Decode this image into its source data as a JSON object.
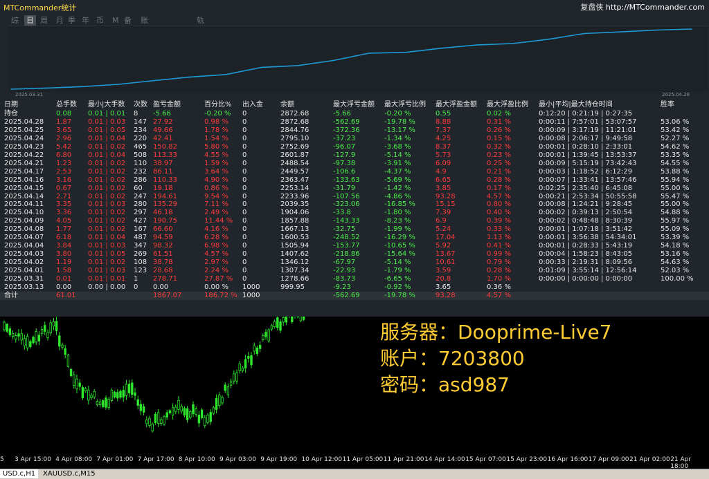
{
  "app": {
    "title": "MTCommander统计",
    "brand_label": "复盘侠",
    "brand_url": "http://MTCommander.com"
  },
  "tabs": [
    "综",
    "日",
    "周",
    "月",
    "季",
    "年",
    "币",
    "M",
    "备",
    "账户",
    "轨迹"
  ],
  "active_tab": "日",
  "equity_chart": {
    "start_date": "2025.03.31",
    "end_date": "2025.04.28",
    "line_color": "#1e9bd7"
  },
  "chart_data": {
    "type": "line",
    "x": [
      "2025.03.13",
      "2025.03.31",
      "2025.04.01",
      "2025.04.02",
      "2025.04.03",
      "2025.04.04",
      "2025.04.07",
      "2025.04.08",
      "2025.04.09",
      "2025.04.10",
      "2025.04.11",
      "2025.04.14",
      "2025.04.15",
      "2025.04.16",
      "2025.04.17",
      "2025.04.21",
      "2025.04.22",
      "2025.04.23",
      "2025.04.24",
      "2025.04.25",
      "2025.04.28"
    ],
    "series": [
      {
        "values": [
          999.95,
          1278.66,
          1307.34,
          1346.12,
          1407.62,
          1505.94,
          1600.53,
          1667.13,
          1857.88,
          1904.06,
          2039.35,
          2233.96,
          2253.14,
          2363.47,
          2449.57,
          2488.54,
          2601.87,
          2752.69,
          2795.1,
          2844.76,
          2872.68
        ]
      }
    ]
  },
  "columns": [
    "日期",
    "总手数",
    "最小|大手数",
    "次数",
    "盈亏金额",
    "百分比%",
    "出入金",
    "余额",
    "最大浮亏金额",
    "最大浮亏比例",
    "最大浮盈金额",
    "最大浮盈比例",
    "最小|平均|最大持仓时间",
    "胜率"
  ],
  "holding_row": {
    "date": "持仓",
    "lots": "0.08",
    "minmax": "0.01 | 0.01",
    "trades": "8",
    "pl": "-5.66",
    "pct": "-0.20 %",
    "io": "0",
    "bal": "2872.68",
    "dd": "-5.66",
    "ddp": "-0.20 %",
    "fp": "0.55",
    "fpp": "0.02 %",
    "hold": "0:12:20 | 0:21:19 | 0:27:35",
    "win": ""
  },
  "rows": [
    {
      "date": "2025.04.28",
      "lots": "1.87",
      "minmax": "0.01 | 0.03",
      "trades": "147",
      "pl": "27.92",
      "pct": "0.98 %",
      "io": "0",
      "bal": "2872.68",
      "dd": "-562.69",
      "ddp": "-19.78 %",
      "fp": "8.88",
      "fpp": "0.31 %",
      "hold": "0:00:11 | 7:57:01 | 53:07:57",
      "win": "53.06 %"
    },
    {
      "date": "2025.04.25",
      "lots": "3.65",
      "minmax": "0.01 | 0.05",
      "trades": "234",
      "pl": "49.66",
      "pct": "1.78 %",
      "io": "0",
      "bal": "2844.76",
      "dd": "-372.36",
      "ddp": "-13.17 %",
      "fp": "7.37",
      "fpp": "0.26 %",
      "hold": "0:00:09 | 3:17:19 | 11:21:01",
      "win": "53.42 %"
    },
    {
      "date": "2025.04.24",
      "lots": "2.96",
      "minmax": "0.01 | 0.04",
      "trades": "220",
      "pl": "42.41",
      "pct": "1.54 %",
      "io": "0",
      "bal": "2795.10",
      "dd": "-37.23",
      "ddp": "-1.34 %",
      "fp": "4.25",
      "fpp": "0.15 %",
      "hold": "0:00:08 | 2:06:17 | 9:49:58",
      "win": "52.27 %"
    },
    {
      "date": "2025.04.23",
      "lots": "5.42",
      "minmax": "0.01 | 0.02",
      "trades": "465",
      "pl": "150.82",
      "pct": "5.80 %",
      "io": "0",
      "bal": "2752.69",
      "dd": "-96.07",
      "ddp": "-3.68 %",
      "fp": "8.37",
      "fpp": "0.32 %",
      "hold": "0:00:01 | 0:28:10 | 2:33:01",
      "win": "54.62 %"
    },
    {
      "date": "2025.04.22",
      "lots": "6.80",
      "minmax": "0.01 | 0.04",
      "trades": "508",
      "pl": "113.33",
      "pct": "4.55 %",
      "io": "0",
      "bal": "2601.87",
      "dd": "-127.9",
      "ddp": "-5.14 %",
      "fp": "5.73",
      "fpp": "0.23 %",
      "hold": "0:00:01 | 1:39:45 | 13:53:37",
      "win": "53.35 %"
    },
    {
      "date": "2025.04.21",
      "lots": "1.23",
      "minmax": "0.01 | 0.02",
      "trades": "110",
      "pl": "38.97",
      "pct": "1.59 %",
      "io": "0",
      "bal": "2488.54",
      "dd": "-97.38",
      "ddp": "-3.91 %",
      "fp": "6.09",
      "fpp": "0.25 %",
      "hold": "0:00:09 | 5:15:19 | 73:42:43",
      "win": "54.55 %"
    },
    {
      "date": "2025.04.17",
      "lots": "2.53",
      "minmax": "0.01 | 0.02",
      "trades": "232",
      "pl": "86.11",
      "pct": "3.64 %",
      "io": "0",
      "bal": "2449.57",
      "dd": "-106.6",
      "ddp": "-4.37 %",
      "fp": "4.9",
      "fpp": "0.21 %",
      "hold": "0:00:03 | 1:18:52 | 6:12:29",
      "win": "53.88 %"
    },
    {
      "date": "2025.04.16",
      "lots": "3.16",
      "minmax": "0.01 | 0.02",
      "trades": "286",
      "pl": "110.33",
      "pct": "4.90 %",
      "io": "0",
      "bal": "2363.47",
      "dd": "-133.63",
      "ddp": "-5.69 %",
      "fp": "6.65",
      "fpp": "0.28 %",
      "hold": "0:00:07 | 1:33:41 | 13:57:46",
      "win": "55.94 %"
    },
    {
      "date": "2025.04.15",
      "lots": "0.67",
      "minmax": "0.01 | 0.02",
      "trades": "60",
      "pl": "19.18",
      "pct": "0.86 %",
      "io": "0",
      "bal": "2253.14",
      "dd": "-31.79",
      "ddp": "-1.42 %",
      "fp": "3.85",
      "fpp": "0.17 %",
      "hold": "0:02:25 | 2:35:40 | 6:45:08",
      "win": "55.00 %"
    },
    {
      "date": "2025.04.14",
      "lots": "2.71",
      "minmax": "0.01 | 0.02",
      "trades": "247",
      "pl": "194.61",
      "pct": "9.54 %",
      "io": "0",
      "bal": "2233.96",
      "dd": "-107.56",
      "ddp": "-4.86 %",
      "fp": "93.28",
      "fpp": "4.57 %",
      "hold": "0:00:21 | 2:53:34 | 50:55:58",
      "win": "55.47 %"
    },
    {
      "date": "2025.04.11",
      "lots": "3.35",
      "minmax": "0.01 | 0.03",
      "trades": "280",
      "pl": "135.29",
      "pct": "7.11 %",
      "io": "0",
      "bal": "2039.35",
      "dd": "-323.06",
      "ddp": "-16.85 %",
      "fp": "15.15",
      "fpp": "0.80 %",
      "hold": "0:00:08 | 1:24:21 | 9:28:45",
      "win": "55.00 %"
    },
    {
      "date": "2025.04.10",
      "lots": "3.36",
      "minmax": "0.01 | 0.02",
      "trades": "297",
      "pl": "46.18",
      "pct": "2.49 %",
      "io": "0",
      "bal": "1904.06",
      "dd": "-33.8",
      "ddp": "-1.80 %",
      "fp": "7.39",
      "fpp": "0.40 %",
      "hold": "0:00:02 | 0:39:13 | 2:50:54",
      "win": "54.88 %"
    },
    {
      "date": "2025.04.09",
      "lots": "4.05",
      "minmax": "0.01 | 0.02",
      "trades": "427",
      "pl": "190.75",
      "pct": "11.44 %",
      "io": "0",
      "bal": "1857.88",
      "dd": "-143.33",
      "ddp": "-8.23 %",
      "fp": "6.9",
      "fpp": "0.39 %",
      "hold": "0:00:02 | 0:48:48 | 8:30:39",
      "win": "55.97 %"
    },
    {
      "date": "2025.04.08",
      "lots": "1.77",
      "minmax": "0.01 | 0.02",
      "trades": "167",
      "pl": "66.60",
      "pct": "4.16 %",
      "io": "0",
      "bal": "1667.13",
      "dd": "-32.75",
      "ddp": "-1.99 %",
      "fp": "5.24",
      "fpp": "0.33 %",
      "hold": "0:00:01 | 1:07:18 | 3:51:42",
      "win": "55.09 %"
    },
    {
      "date": "2025.04.07",
      "lots": "6.18",
      "minmax": "0.01 | 0.04",
      "trades": "487",
      "pl": "94.59",
      "pct": "6.28 %",
      "io": "0",
      "bal": "1600.53",
      "dd": "-248.52",
      "ddp": "-16.29 %",
      "fp": "17.04",
      "fpp": "1.13 %",
      "hold": "0:00:01 | 3:56:38 | 54:34:01",
      "win": "53.39 %"
    },
    {
      "date": "2025.04.04",
      "lots": "3.84",
      "minmax": "0.01 | 0.03",
      "trades": "347",
      "pl": "98.32",
      "pct": "6.98 %",
      "io": "0",
      "bal": "1505.94",
      "dd": "-153.77",
      "ddp": "-10.65 %",
      "fp": "5.92",
      "fpp": "0.41 %",
      "hold": "0:00:01 | 0:28:33 | 5:43:19",
      "win": "54.18 %"
    },
    {
      "date": "2025.04.03",
      "lots": "3.80",
      "minmax": "0.01 | 0.05",
      "trades": "269",
      "pl": "61.51",
      "pct": "4.57 %",
      "io": "0",
      "bal": "1407.62",
      "dd": "-218.86",
      "ddp": "-15.64 %",
      "fp": "13.67",
      "fpp": "0.99 %",
      "hold": "0:00:04 | 1:58:23 | 8:43:05",
      "win": "53.16 %"
    },
    {
      "date": "2025.04.02",
      "lots": "1.19",
      "minmax": "0.01 | 0.02",
      "trades": "108",
      "pl": "38.78",
      "pct": "2.97 %",
      "io": "0",
      "bal": "1346.12",
      "dd": "-67.97",
      "ddp": "-5.14 %",
      "fp": "10.61",
      "fpp": "0.79 %",
      "hold": "0:00:33 | 2:19:31 | 8:09:56",
      "win": "54.63 %"
    },
    {
      "date": "2025.04.01",
      "lots": "1.58",
      "minmax": "0.01 | 0.03",
      "trades": "123",
      "pl": "28.68",
      "pct": "2.24 %",
      "io": "0",
      "bal": "1307.34",
      "dd": "-22.93",
      "ddp": "-1.79 %",
      "fp": "3.59",
      "fpp": "0.28 %",
      "hold": "0:01:09 | 3:55:14 | 12:56:14",
      "win": "52.03 %"
    },
    {
      "date": "2025.03.31",
      "lots": "0.01",
      "minmax": "0.01 | 0.01",
      "trades": "1",
      "pl": "278.71",
      "pct": "27.87 %",
      "io": "0",
      "bal": "1278.66",
      "dd": "-83.73",
      "ddp": "-6.65 %",
      "fp": "20.8",
      "fpp": "1.70 %",
      "hold": "0:00:00 | 0:00:00 | 0:00:00",
      "win": "100.00 %"
    },
    {
      "date": "2025.03.13",
      "lots": "0.00",
      "minmax": "0.00 | 0.00",
      "trades": "0",
      "pl": "0.00",
      "pct": "0.00 %",
      "io": "1000",
      "bal": "999.95",
      "dd": "-9.23",
      "ddp": "-0.92 %",
      "fp": "3.65",
      "fpp": "0.36 %",
      "hold": "",
      "win": ""
    }
  ],
  "total_row": {
    "date": "合计",
    "lots": "61.01",
    "minmax": "",
    "trades": "",
    "pl": "1867.07",
    "pct": "186.72 %",
    "io": "1000",
    "bal": "",
    "dd": "-562.69",
    "ddp": "-19.78 %",
    "fp": "93.28",
    "fpp": "4.57 %",
    "hold": "",
    "win": ""
  },
  "overlay": {
    "server": "服务器：Dooprime-Live7",
    "account": "账户：7203800",
    "password": "密码：asd987"
  },
  "time_axis": [
    "5",
    "3 Apr 15:00",
    "4 Apr 08:00",
    "7 Apr 01:00",
    "7 Apr 17:00",
    "8 Apr 10:00",
    "9 Apr 03:00",
    "9 Apr 19:00",
    "10 Apr 12:00",
    "11 Apr 05:00",
    "11 Apr 21:00",
    "14 Apr 14:00",
    "15 Apr 07:00",
    "15 Apr 23:00",
    "16 Apr 16:00",
    "17 Apr 09:00",
    "21 Apr 02:00",
    "21 Apr 18:00"
  ],
  "bottom_tabs": [
    "USD.c,H1",
    "XAUUSD.c,M15"
  ],
  "colors": {
    "profit": "#ff3b3b",
    "loss": "#4cef4c",
    "accent": "#ffcc33",
    "candle": "#2ee82e"
  }
}
